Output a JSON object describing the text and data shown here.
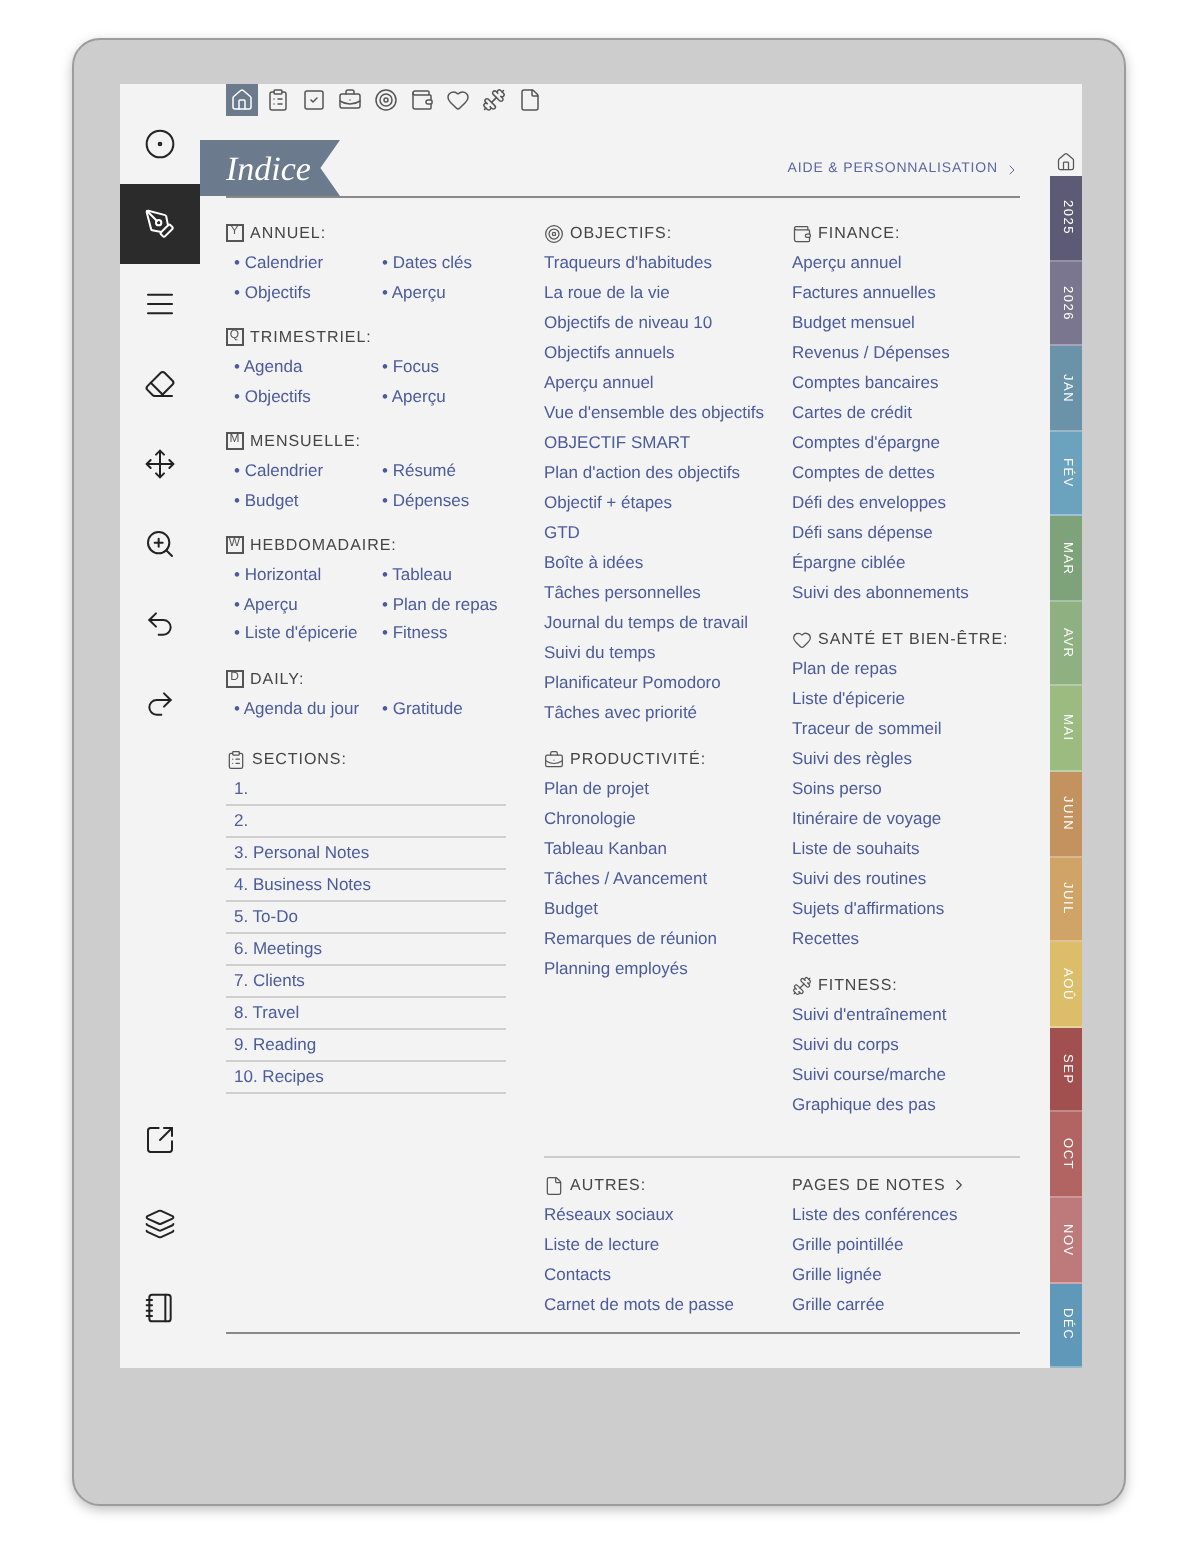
{
  "toolbar": {
    "top": [
      {
        "kind": "pointer",
        "selected": false
      },
      {
        "kind": "pen",
        "selected": true
      },
      {
        "kind": "lines",
        "selected": false
      },
      {
        "kind": "eraser",
        "selected": false
      },
      {
        "kind": "move",
        "selected": false
      },
      {
        "kind": "zoom",
        "selected": false
      },
      {
        "kind": "undo",
        "selected": false
      },
      {
        "kind": "redo",
        "selected": false
      }
    ],
    "bottom": [
      {
        "kind": "export",
        "selected": false
      },
      {
        "kind": "layers",
        "selected": false
      },
      {
        "kind": "notebook",
        "selected": false
      }
    ]
  },
  "top_icons": [
    {
      "kind": "home",
      "selected": true
    },
    {
      "kind": "clipboard",
      "selected": false
    },
    {
      "kind": "check",
      "selected": false
    },
    {
      "kind": "briefcase",
      "selected": false
    },
    {
      "kind": "target",
      "selected": false
    },
    {
      "kind": "wallet",
      "selected": false
    },
    {
      "kind": "heart",
      "selected": false
    },
    {
      "kind": "fitness",
      "selected": false
    },
    {
      "kind": "page",
      "selected": false
    }
  ],
  "title": "Indice",
  "help_link": "AIDE & PERSONNALISATION",
  "left_groups": [
    {
      "badge": "Y",
      "title": "ANNUEL:",
      "items": [
        "• Calendrier",
        "• Dates clés",
        "• Objectifs",
        "• Aperçu"
      ]
    },
    {
      "badge": "Q",
      "title": "TRIMESTRIEL:",
      "items": [
        "• Agenda",
        "• Focus",
        "• Objectifs",
        "• Aperçu"
      ]
    },
    {
      "badge": "M",
      "title": "MENSUELLE:",
      "items": [
        "• Calendrier",
        "• Résumé",
        "• Budget",
        "• Dépenses"
      ]
    },
    {
      "badge": "W",
      "title": "HEBDOMADAIRE:",
      "items": [
        "• Horizontal",
        "• Tableau",
        "• Aperçu",
        "• Plan de repas",
        "• Liste d'épicerie",
        "• Fitness"
      ]
    },
    {
      "badge": "D",
      "title": "DAILY:",
      "items": [
        "• Agenda du jour",
        "• Gratitude"
      ]
    }
  ],
  "sections": {
    "title": "SECTIONS:",
    "items": [
      "1.",
      "2.",
      "3. Personal Notes",
      "4. Business Notes",
      "5. To-Do",
      "6. Meetings",
      "7. Clients",
      "8. Travel",
      "9. Reading",
      "10. Recipes"
    ]
  },
  "middle_groups": [
    {
      "kind": "target",
      "title": "OBJECTIFS:",
      "items": [
        "Traqueurs d'habitudes",
        "La roue de la vie",
        "Objectifs de niveau 10",
        "Objectifs annuels",
        "Aperçu annuel",
        "Vue d'ensemble des objectifs",
        "OBJECTIF SMART",
        "Plan d'action des objectifs",
        "Objectif + étapes",
        "GTD",
        "Boîte à idées",
        "Tâches personnelles",
        "Journal du temps de travail",
        "Suivi du temps",
        "Planificateur Pomodoro",
        "Tâches avec priorité"
      ]
    },
    {
      "kind": "briefcase",
      "title": "PRODUCTIVITÉ:",
      "items": [
        "Plan de projet",
        "Chronologie",
        "Tableau Kanban",
        "Tâches / Avancement",
        "Budget",
        "Remarques de réunion",
        "Planning employés"
      ]
    }
  ],
  "right_groups": [
    {
      "kind": "wallet",
      "title": "FINANCE:",
      "items": [
        "Aperçu annuel",
        "Factures annuelles",
        "Budget mensuel",
        "Revenus / Dépenses",
        "Comptes bancaires",
        "Cartes de crédit",
        "Comptes d'épargne",
        "Comptes de dettes",
        "Défi des enveloppes",
        "Défi sans dépense",
        "Épargne ciblée",
        "Suivi des abonnements"
      ]
    },
    {
      "kind": "heart",
      "title": "SANTÉ ET BIEN-ÊTRE:",
      "items": [
        "Plan de repas",
        "Liste d'épicerie",
        "Traceur de sommeil",
        "Suivi des règles",
        "Soins perso",
        "Itinéraire de voyage",
        "Liste de souhaits",
        "Suivi des routines",
        "Sujets d'affirmations",
        "Recettes"
      ]
    },
    {
      "kind": "fitness",
      "title": "FITNESS:",
      "items": [
        "Suivi d'entraînement",
        "Suivi du corps",
        "Suivi course/marche",
        "Graphique des pas"
      ]
    }
  ],
  "others": {
    "title": "AUTRES:",
    "items": [
      "Réseaux sociaux",
      "Liste de lecture",
      "Contacts",
      "Carnet de mots de passe"
    ]
  },
  "notes_pages": {
    "title": "PAGES DE NOTES",
    "items": [
      "Liste des conférences",
      "Grille pointillée",
      "Grille lignée",
      "Grille carrée"
    ]
  },
  "side_tabs": [
    {
      "label": "2025",
      "color": "#5d5a75"
    },
    {
      "label": "2026",
      "color": "#7b7690"
    },
    {
      "label": "JAN",
      "color": "#6a93aa"
    },
    {
      "label": "FÉV",
      "color": "#6ba3bf"
    },
    {
      "label": "MAR",
      "color": "#7ea27a"
    },
    {
      "label": "AVR",
      "color": "#8fb080"
    },
    {
      "label": "MAI",
      "color": "#9bbb80"
    },
    {
      "label": "JUIN",
      "color": "#c4925e"
    },
    {
      "label": "JUIL",
      "color": "#cfa466"
    },
    {
      "label": "AOÛ",
      "color": "#dcbd6a"
    },
    {
      "label": "SEP",
      "color": "#a2504f"
    },
    {
      "label": "OCT",
      "color": "#b26463"
    },
    {
      "label": "NOV",
      "color": "#be7a7b"
    },
    {
      "label": "DÉC",
      "color": "#5f98b8"
    }
  ]
}
